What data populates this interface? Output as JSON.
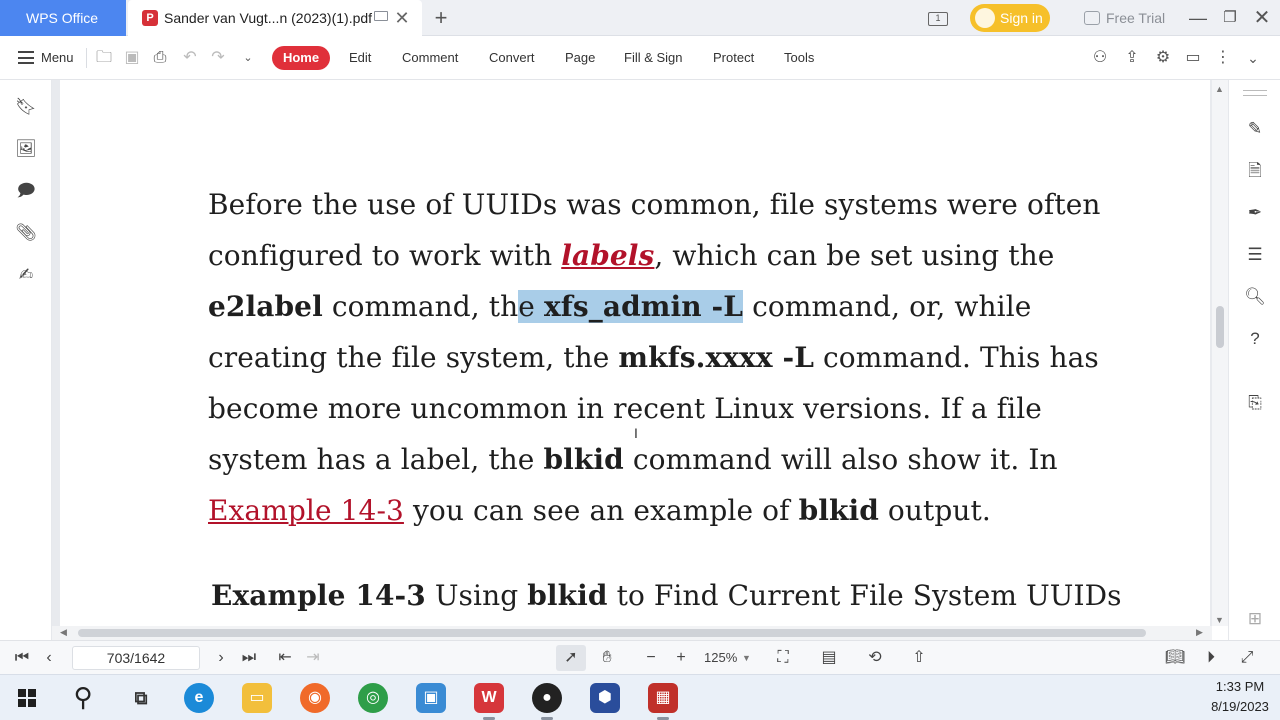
{
  "titlebar": {
    "app_tab_label": "WPS Office",
    "doc_tab_title": "Sander van Vugt...n (2023)(1).pdf",
    "signin_label": "Sign in",
    "free_trial_label": "Free Trial",
    "workspace_badge": "1"
  },
  "menubar": {
    "menu_label": "Menu",
    "tabs": [
      "Home",
      "Edit",
      "Comment",
      "Convert",
      "Page",
      "Fill & Sign",
      "Protect",
      "Tools"
    ],
    "active_tab": "Home"
  },
  "document": {
    "line1": "Before the use of UUIDs was common, file systems were often",
    "line2_a": "configured to work with ",
    "line2_link": "labels",
    "line2_b": ", which can be set using the",
    "line3_bold1": "e2label",
    "line3_a": " command, th",
    "line3_hl_plain": "e ",
    "line3_hl_bold": "xfs_admin -L",
    "line3_b": " command, or, while",
    "line4_a": "creating the file system, the ",
    "line4_bold": "mkfs.xxxx -L",
    "line4_b": " command. This has",
    "line5": "become more uncommon in recent Linux versions. If a file",
    "line6_a": "system has a label, the ",
    "line6_bold": "blkid",
    "line6_b": " command will also show it. In",
    "line7_link": "Example 14-3",
    "line7_a": " you can see an example of ",
    "line7_bold": "blkid",
    "line7_b": " output.",
    "caption_bold1": "Example 14-3",
    "caption_a": " Using ",
    "caption_bold2": "blkid",
    "caption_b": " to Find Current File System UUIDs"
  },
  "statusbar": {
    "page_indicator": "703/1642",
    "zoom": "125%"
  },
  "taskbar": {
    "time": "1:33 PM",
    "date": "8/19/2023"
  },
  "colors": {
    "wps_blue": "#4c86f0",
    "home_red": "#e0303a",
    "link_red": "#b2122a",
    "highlight": "#a9cde8",
    "signin_yellow": "#f6c02a"
  },
  "icons": {
    "leftbar": [
      "bookmark-icon",
      "image-icon",
      "comment-icon",
      "attachment-icon",
      "signature-icon"
    ],
    "rightbar": [
      "edit-icon",
      "document-icon",
      "pen-icon",
      "list-icon",
      "search-icon",
      "help-icon",
      "translate-icon",
      "grid-icon"
    ]
  }
}
